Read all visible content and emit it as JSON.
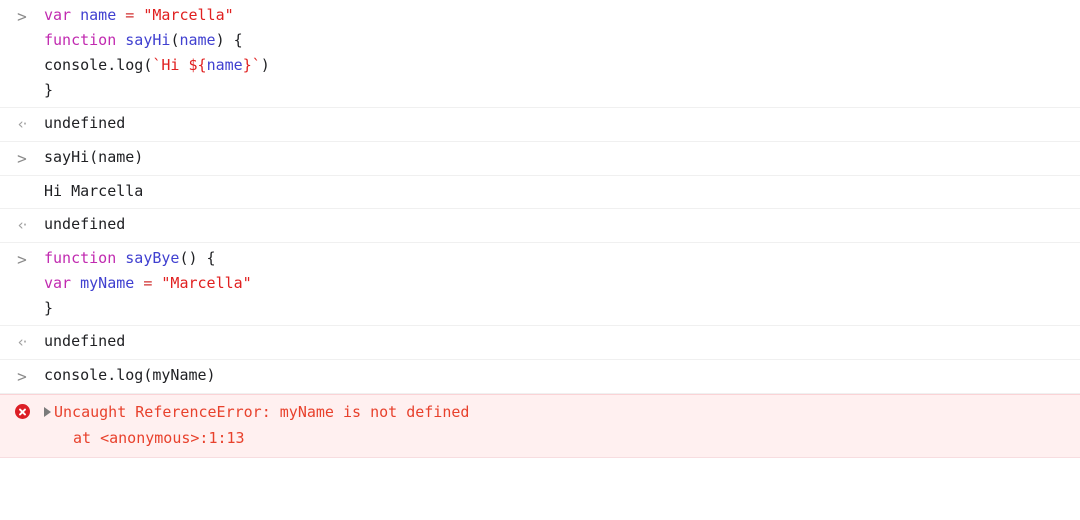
{
  "console": {
    "name": "devtools-console",
    "prompt_glyph": ">",
    "return_glyph": "‹·",
    "rows": [
      {
        "id": "input-var-name-sayhi",
        "kind": "input",
        "gutter_icon": "prompt-arrow-icon",
        "lines": [
          [
            {
              "text": "var ",
              "token": "kw"
            },
            {
              "text": "name ",
              "token": "ident"
            },
            {
              "text": "= ",
              "token": "op"
            },
            {
              "text": "\"Marcella\"",
              "token": "str"
            }
          ],
          [
            {
              "text": "function ",
              "token": "kw"
            },
            {
              "text": "sayHi",
              "token": "ident"
            },
            {
              "text": "(",
              "token": "plain"
            },
            {
              "text": "name",
              "token": "ident"
            },
            {
              "text": ") {",
              "token": "plain"
            }
          ],
          [
            {
              "text": "console.log(",
              "token": "plain"
            },
            {
              "text": "`Hi ${",
              "token": "str"
            },
            {
              "text": "name",
              "token": "ident"
            },
            {
              "text": "}`",
              "token": "str"
            },
            {
              "text": ")",
              "token": "plain"
            }
          ],
          [
            {
              "text": "}",
              "token": "plain"
            }
          ]
        ]
      },
      {
        "id": "return-undefined-1",
        "kind": "return",
        "gutter_icon": "return-arrow-icon",
        "lines": [
          [
            {
              "text": "undefined",
              "token": "plain"
            }
          ]
        ]
      },
      {
        "id": "input-sayhi-call",
        "kind": "input",
        "gutter_icon": "prompt-arrow-icon",
        "lines": [
          [
            {
              "text": "sayHi(name)",
              "token": "plain"
            }
          ]
        ]
      },
      {
        "id": "output-hi-marcella",
        "kind": "output",
        "gutter_icon": "",
        "lines": [
          [
            {
              "text": "Hi Marcella",
              "token": "plain"
            }
          ]
        ]
      },
      {
        "id": "return-undefined-2",
        "kind": "return",
        "gutter_icon": "return-arrow-icon",
        "lines": [
          [
            {
              "text": "undefined",
              "token": "plain"
            }
          ]
        ]
      },
      {
        "id": "input-function-saybye",
        "kind": "input",
        "gutter_icon": "prompt-arrow-icon",
        "lines": [
          [
            {
              "text": "function ",
              "token": "kw"
            },
            {
              "text": "sayBye",
              "token": "ident"
            },
            {
              "text": "() {",
              "token": "plain"
            }
          ],
          [
            {
              "text": "var ",
              "token": "kw"
            },
            {
              "text": "myName ",
              "token": "ident"
            },
            {
              "text": "= ",
              "token": "op"
            },
            {
              "text": "\"Marcella\"",
              "token": "str"
            }
          ],
          [
            {
              "text": "}",
              "token": "plain"
            }
          ]
        ]
      },
      {
        "id": "return-undefined-3",
        "kind": "return",
        "gutter_icon": "return-arrow-icon",
        "lines": [
          [
            {
              "text": "undefined",
              "token": "plain"
            }
          ]
        ]
      },
      {
        "id": "input-console-log-myname",
        "kind": "input",
        "gutter_icon": "prompt-arrow-icon",
        "lines": [
          [
            {
              "text": "console.log(myName)",
              "token": "plain"
            }
          ]
        ]
      },
      {
        "id": "error-reference-error",
        "kind": "error",
        "gutter_icon": "error-circle-x-icon",
        "disclosure_icon": "disclosure-triangle-right-icon",
        "message": "Uncaught ReferenceError: myName is not defined",
        "stack_line": "at <anonymous>:1:13"
      }
    ]
  },
  "colors": {
    "background": "#ffffff",
    "text": "#202124",
    "return_text": "#868686",
    "keyword": "#c12ab0",
    "identifier": "#4040d0",
    "string": "#e02020",
    "operator": "#d03030",
    "error_text": "#e8412c",
    "error_background": "#fff0f0",
    "error_border": "#f7dde0",
    "error_icon": "#dc1f26",
    "divider": "#f0f0f0",
    "gutter_glyph": "#8a8a8a"
  }
}
